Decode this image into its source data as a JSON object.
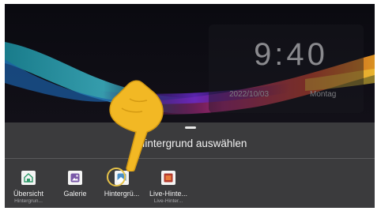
{
  "clock": {
    "time": "9:40",
    "date": "2022/10/03",
    "day": "Montag"
  },
  "sheet": {
    "title": "Hintergrund auswählen"
  },
  "options": [
    {
      "label": "Übersicht",
      "sub": "Hintergrun...",
      "icon": "home-wallpaper-icon"
    },
    {
      "label": "Galerie",
      "sub": "",
      "icon": "gallery-icon"
    },
    {
      "label": "Hintergrü...",
      "sub": "",
      "icon": "wallpaper-icon"
    },
    {
      "label": "Live-Hinte...",
      "sub": "Live-Hinter...",
      "icon": "live-wallpaper-icon"
    }
  ],
  "colors": {
    "panel": "#3b3b3d",
    "icon_accent": "#7a59a8",
    "live_icon": "#b23a2e",
    "pointer_hand": "#f2b824"
  }
}
